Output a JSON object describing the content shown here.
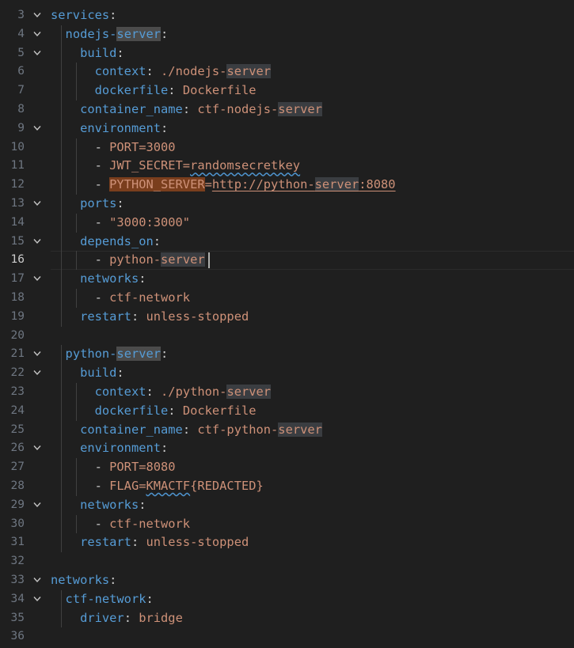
{
  "colors": {
    "background": "#1f1f1f",
    "key": "#569cd6",
    "string": "#ce9178",
    "punctuation": "#cccccc",
    "line_number": "#6e7681",
    "match_highlight": "#3a3d41",
    "orange_highlight": "#7a3e1d"
  },
  "icons": {
    "fold": "chevron-down-icon"
  },
  "editor": {
    "current_line": "16",
    "lines": [
      {
        "n": "3",
        "fold": true,
        "segs": [
          {
            "c": "k",
            "t": "services"
          },
          {
            "c": "p",
            "t": ":"
          }
        ]
      },
      {
        "n": "4",
        "fold": true,
        "segs": [
          {
            "c": "p",
            "t": "  "
          },
          {
            "c": "k",
            "t": "nodejs-"
          },
          {
            "c": "k hl-sel",
            "t": "server"
          },
          {
            "c": "p",
            "t": ":"
          }
        ]
      },
      {
        "n": "5",
        "fold": true,
        "segs": [
          {
            "c": "p",
            "t": "    "
          },
          {
            "c": "k",
            "t": "build"
          },
          {
            "c": "p",
            "t": ":"
          }
        ]
      },
      {
        "n": "6",
        "fold": false,
        "segs": [
          {
            "c": "p",
            "t": "      "
          },
          {
            "c": "k",
            "t": "context"
          },
          {
            "c": "p",
            "t": ": "
          },
          {
            "c": "s",
            "t": "./nodejs-"
          },
          {
            "c": "s hl",
            "t": "server"
          }
        ]
      },
      {
        "n": "7",
        "fold": false,
        "segs": [
          {
            "c": "p",
            "t": "      "
          },
          {
            "c": "k",
            "t": "dockerfile"
          },
          {
            "c": "p",
            "t": ": "
          },
          {
            "c": "s",
            "t": "Dockerfile"
          }
        ]
      },
      {
        "n": "8",
        "fold": false,
        "segs": [
          {
            "c": "p",
            "t": "    "
          },
          {
            "c": "k",
            "t": "container_name"
          },
          {
            "c": "p",
            "t": ": "
          },
          {
            "c": "s",
            "t": "ctf-nodejs-"
          },
          {
            "c": "s hl",
            "t": "server"
          }
        ]
      },
      {
        "n": "9",
        "fold": true,
        "segs": [
          {
            "c": "p",
            "t": "    "
          },
          {
            "c": "k",
            "t": "environment"
          },
          {
            "c": "p",
            "t": ":"
          }
        ]
      },
      {
        "n": "10",
        "fold": false,
        "segs": [
          {
            "c": "p",
            "t": "      - "
          },
          {
            "c": "s",
            "t": "PORT=3000"
          }
        ]
      },
      {
        "n": "11",
        "fold": false,
        "segs": [
          {
            "c": "p",
            "t": "      - "
          },
          {
            "c": "s",
            "t": "JWT_SECRET="
          },
          {
            "c": "s squig",
            "t": "randomsecretkey"
          }
        ]
      },
      {
        "n": "12",
        "fold": false,
        "segs": [
          {
            "c": "p",
            "t": "      - "
          },
          {
            "c": "hl-orange",
            "t": "PYTHON_SERVER"
          },
          {
            "c": "s",
            "t": "="
          },
          {
            "c": "s underline",
            "t": "http://python-"
          },
          {
            "c": "s underline hl",
            "t": "server"
          },
          {
            "c": "s underline",
            "t": ":8080"
          }
        ]
      },
      {
        "n": "13",
        "fold": true,
        "segs": [
          {
            "c": "p",
            "t": "    "
          },
          {
            "c": "k",
            "t": "ports"
          },
          {
            "c": "p",
            "t": ":"
          }
        ]
      },
      {
        "n": "14",
        "fold": false,
        "segs": [
          {
            "c": "p",
            "t": "      - "
          },
          {
            "c": "s",
            "t": "\"3000:3000\""
          }
        ]
      },
      {
        "n": "15",
        "fold": true,
        "segs": [
          {
            "c": "p",
            "t": "    "
          },
          {
            "c": "k",
            "t": "depends_on"
          },
          {
            "c": "p",
            "t": ":"
          }
        ]
      },
      {
        "n": "16",
        "fold": false,
        "segs": [
          {
            "c": "p",
            "t": "      - "
          },
          {
            "c": "s",
            "t": "python-"
          },
          {
            "c": "s hl",
            "t": "server"
          }
        ]
      },
      {
        "n": "17",
        "fold": true,
        "segs": [
          {
            "c": "p",
            "t": "    "
          },
          {
            "c": "k",
            "t": "networks"
          },
          {
            "c": "p",
            "t": ":"
          }
        ]
      },
      {
        "n": "18",
        "fold": false,
        "segs": [
          {
            "c": "p",
            "t": "      - "
          },
          {
            "c": "s",
            "t": "ctf-network"
          }
        ]
      },
      {
        "n": "19",
        "fold": false,
        "segs": [
          {
            "c": "p",
            "t": "    "
          },
          {
            "c": "k",
            "t": "restart"
          },
          {
            "c": "p",
            "t": ": "
          },
          {
            "c": "s",
            "t": "unless-stopped"
          }
        ]
      },
      {
        "n": "20",
        "fold": false,
        "segs": []
      },
      {
        "n": "21",
        "fold": true,
        "segs": [
          {
            "c": "p",
            "t": "  "
          },
          {
            "c": "k",
            "t": "python-"
          },
          {
            "c": "k hl-sel",
            "t": "server"
          },
          {
            "c": "p",
            "t": ":"
          }
        ]
      },
      {
        "n": "22",
        "fold": true,
        "segs": [
          {
            "c": "p",
            "t": "    "
          },
          {
            "c": "k",
            "t": "build"
          },
          {
            "c": "p",
            "t": ":"
          }
        ]
      },
      {
        "n": "23",
        "fold": false,
        "segs": [
          {
            "c": "p",
            "t": "      "
          },
          {
            "c": "k",
            "t": "context"
          },
          {
            "c": "p",
            "t": ": "
          },
          {
            "c": "s",
            "t": "./python-"
          },
          {
            "c": "s hl",
            "t": "server"
          }
        ]
      },
      {
        "n": "24",
        "fold": false,
        "segs": [
          {
            "c": "p",
            "t": "      "
          },
          {
            "c": "k",
            "t": "dockerfile"
          },
          {
            "c": "p",
            "t": ": "
          },
          {
            "c": "s",
            "t": "Dockerfile"
          }
        ]
      },
      {
        "n": "25",
        "fold": false,
        "segs": [
          {
            "c": "p",
            "t": "    "
          },
          {
            "c": "k",
            "t": "container_name"
          },
          {
            "c": "p",
            "t": ": "
          },
          {
            "c": "s",
            "t": "ctf-python-"
          },
          {
            "c": "s hl",
            "t": "server"
          }
        ]
      },
      {
        "n": "26",
        "fold": true,
        "segs": [
          {
            "c": "p",
            "t": "    "
          },
          {
            "c": "k",
            "t": "environment"
          },
          {
            "c": "p",
            "t": ":"
          }
        ]
      },
      {
        "n": "27",
        "fold": false,
        "segs": [
          {
            "c": "p",
            "t": "      - "
          },
          {
            "c": "s",
            "t": "PORT=8080"
          }
        ]
      },
      {
        "n": "28",
        "fold": false,
        "segs": [
          {
            "c": "p",
            "t": "      - "
          },
          {
            "c": "s",
            "t": "FLAG="
          },
          {
            "c": "s squig",
            "t": "KMACTF"
          },
          {
            "c": "s",
            "t": "{REDACTED}"
          }
        ]
      },
      {
        "n": "29",
        "fold": true,
        "segs": [
          {
            "c": "p",
            "t": "    "
          },
          {
            "c": "k",
            "t": "networks"
          },
          {
            "c": "p",
            "t": ":"
          }
        ]
      },
      {
        "n": "30",
        "fold": false,
        "segs": [
          {
            "c": "p",
            "t": "      - "
          },
          {
            "c": "s",
            "t": "ctf-network"
          }
        ]
      },
      {
        "n": "31",
        "fold": false,
        "segs": [
          {
            "c": "p",
            "t": "    "
          },
          {
            "c": "k",
            "t": "restart"
          },
          {
            "c": "p",
            "t": ": "
          },
          {
            "c": "s",
            "t": "unless-stopped"
          }
        ]
      },
      {
        "n": "32",
        "fold": false,
        "segs": []
      },
      {
        "n": "33",
        "fold": true,
        "segs": [
          {
            "c": "k",
            "t": "networks"
          },
          {
            "c": "p",
            "t": ":"
          }
        ]
      },
      {
        "n": "34",
        "fold": true,
        "segs": [
          {
            "c": "p",
            "t": "  "
          },
          {
            "c": "k",
            "t": "ctf-network"
          },
          {
            "c": "p",
            "t": ":"
          }
        ]
      },
      {
        "n": "35",
        "fold": false,
        "segs": [
          {
            "c": "p",
            "t": "    "
          },
          {
            "c": "k",
            "t": "driver"
          },
          {
            "c": "p",
            "t": ": "
          },
          {
            "c": "s",
            "t": "bridge"
          }
        ]
      },
      {
        "n": "36",
        "fold": false,
        "segs": []
      }
    ]
  }
}
